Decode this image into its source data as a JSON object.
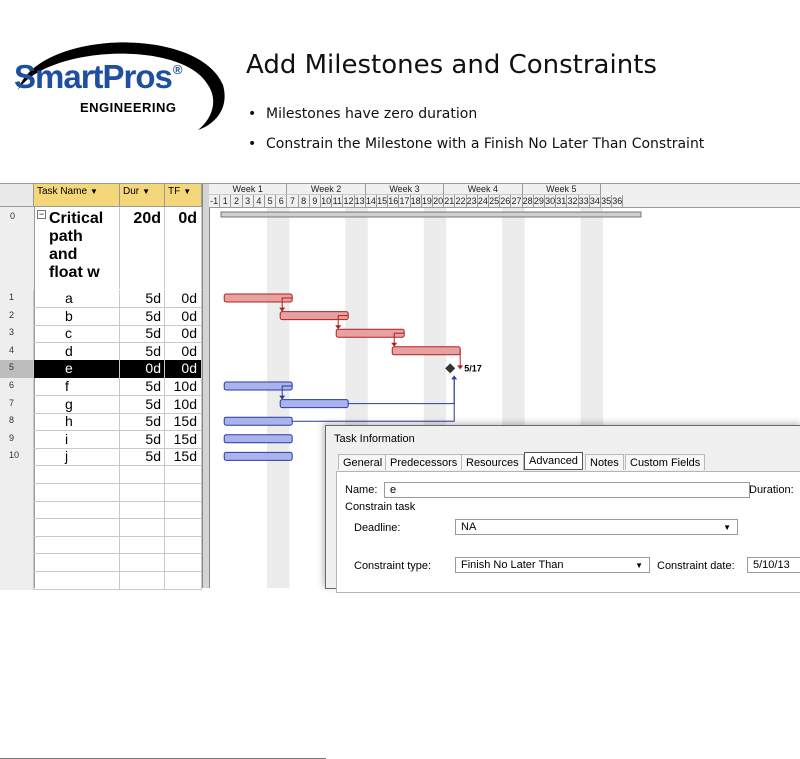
{
  "slide": {
    "logo": {
      "brand": "SmartPros",
      "reg_mark": "®",
      "subtitle": "ENGINEERING",
      "brand_color": "#1f4fa0"
    },
    "title": "Add Milestones and Constraints",
    "bullets": [
      "Milestones have zero duration",
      "Constrain the Milestone with a Finish No Later Than Constraint"
    ]
  },
  "grid": {
    "headers": {
      "name": "Task Name",
      "dur": "Dur",
      "tf": "TF",
      "dropdown_icon": "▼"
    },
    "summary": {
      "id": "0",
      "toggle": "−",
      "name_lines": [
        "Critical",
        "path",
        "and",
        "float w"
      ],
      "dur": "20d",
      "tf": "0d"
    },
    "rows": [
      {
        "id": "1",
        "name": "a",
        "dur": "5d",
        "tf": "0d"
      },
      {
        "id": "2",
        "name": "b",
        "dur": "5d",
        "tf": "0d"
      },
      {
        "id": "3",
        "name": "c",
        "dur": "5d",
        "tf": "0d"
      },
      {
        "id": "4",
        "name": "d",
        "dur": "5d",
        "tf": "0d"
      },
      {
        "id": "5",
        "name": "e",
        "dur": "0d",
        "tf": "0d",
        "selected": true
      },
      {
        "id": "6",
        "name": "f",
        "dur": "5d",
        "tf": "10d"
      },
      {
        "id": "7",
        "name": "g",
        "dur": "5d",
        "tf": "10d"
      },
      {
        "id": "8",
        "name": "h",
        "dur": "5d",
        "tf": "15d"
      },
      {
        "id": "9",
        "name": "i",
        "dur": "5d",
        "tf": "15d"
      },
      {
        "id": "10",
        "name": "j",
        "dur": "5d",
        "tf": "15d"
      }
    ]
  },
  "timescale": {
    "weeks": [
      "Week 1",
      "Week 2",
      "Week 3",
      "Week 4",
      "Week 5"
    ],
    "days": [
      "-1",
      "1",
      "2",
      "3",
      "4",
      "5",
      "6",
      "7",
      "8",
      "9",
      "10",
      "11",
      "12",
      "13",
      "14",
      "15",
      "16",
      "17",
      "18",
      "19",
      "20",
      "21",
      "22",
      "23",
      "24",
      "25",
      "26",
      "27",
      "28",
      "29",
      "30",
      "31",
      "32",
      "33",
      "34",
      "35",
      "36"
    ]
  },
  "gantt": {
    "milestone_label": "5/17",
    "critical_color": "#e8a0a0",
    "critical_border": "#b02020",
    "noncritical_color": "#a9b4ee",
    "noncritical_border": "#2a3aa0",
    "summary_color": "#cfcfcf"
  },
  "dialog": {
    "title": "Task Information",
    "tabs": [
      "General",
      "Predecessors",
      "Resources",
      "Advanced",
      "Notes",
      "Custom Fields"
    ],
    "active_tab": "Advanced",
    "name_label": "Name:",
    "name_value": "e",
    "duration_label": "Duration:",
    "constrain_group": "Constrain task",
    "deadline_label": "Deadline:",
    "deadline_value": "NA",
    "constraint_type_label": "Constraint type:",
    "constraint_type_value": "Finish No Later Than",
    "constraint_date_label": "Constraint date:",
    "constraint_date_value": "5/10/13",
    "dropdown_icon": "▼"
  }
}
